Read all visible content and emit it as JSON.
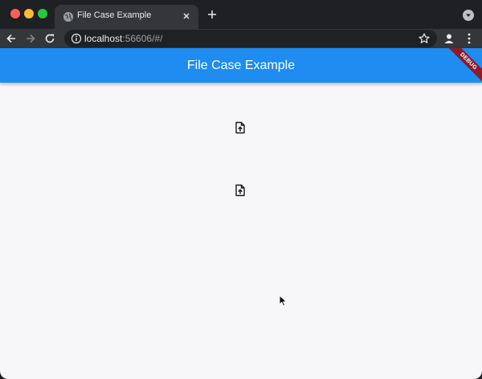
{
  "browser": {
    "tab": {
      "title": "File Case Example",
      "favicon": "globe-icon"
    },
    "url": {
      "host": "localhost",
      "rest": ":56606/#/"
    },
    "colors": {
      "frame": "#1f2023",
      "toolbar": "#35363a",
      "omnibox": "#202124"
    }
  },
  "app": {
    "title": "File Case Example",
    "debug_label": "DEBUG",
    "colors": {
      "appbar": "#1e8cf0",
      "background": "#f7f6f9",
      "ribbon": "#8a1c2b"
    },
    "upload_buttons": [
      {
        "icon": "file-upload-icon"
      },
      {
        "icon": "file-upload-icon"
      }
    ]
  }
}
